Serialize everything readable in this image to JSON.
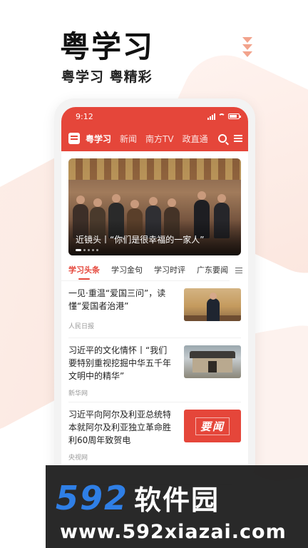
{
  "hero": {
    "title": "粤学习",
    "subtitle": "粤学习 粤精彩"
  },
  "status_bar": {
    "time": "9:12"
  },
  "nav": {
    "tabs": [
      {
        "label": "粤学习",
        "active": true
      },
      {
        "label": "新闻",
        "active": false
      },
      {
        "label": "南方TV",
        "active": false
      },
      {
        "label": "政直通",
        "active": false
      }
    ],
    "icons": [
      "logo-icon",
      "search-icon",
      "menu-icon"
    ]
  },
  "banner": {
    "caption": "近镜头丨“你们是很幸福的一家人”",
    "slide_count": 5,
    "active_slide": 1
  },
  "subtabs": [
    {
      "label": "学习头条",
      "active": true
    },
    {
      "label": "学习金句",
      "active": false
    },
    {
      "label": "学习时评",
      "active": false
    },
    {
      "label": "广东要闻",
      "active": false
    }
  ],
  "articles": [
    {
      "title": "一见·重温“爱国三问”，读懂“爱国者治港”",
      "source": "人民日报",
      "thumb": "speech-photo"
    },
    {
      "title": "习近平的文化情怀丨“我们要特别重视挖掘中华五千年文明中的精华”",
      "source": "新华网",
      "thumb": "building-photo"
    },
    {
      "title": "习近平向阿尔及利亚总统特本就阿尔及利亚独立革命胜利60周年致贺电",
      "source": "央视网",
      "thumb_text": "要闻"
    }
  ],
  "watermark": {
    "number": "592",
    "brand": "软件园",
    "url": "www.592xiazai.com"
  },
  "colors": {
    "accent": "#e5463a",
    "watermark_blue": "#2f7fe6"
  }
}
